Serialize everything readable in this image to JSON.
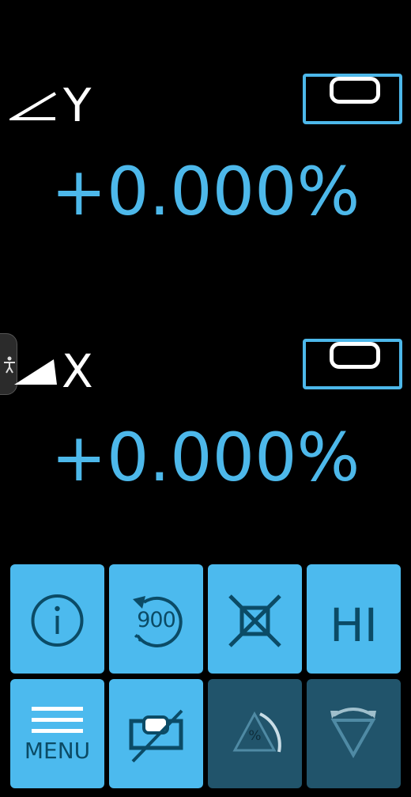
{
  "colors": {
    "accent": "#4db8ea",
    "button": "#4cbaee",
    "button_disabled": "#21546b",
    "button_ink": "#0b4b66",
    "disabled_ink": "#4f8aa4"
  },
  "y_axis": {
    "label": "Y",
    "icon": "angle-icon",
    "reading": "+0.000%",
    "level_icon": "bubble-level-icon"
  },
  "x_axis": {
    "label": "X",
    "icon": "slope-wedge-icon",
    "reading": "+0.000%",
    "level_icon": "bubble-level-icon"
  },
  "accessibility_tab": {
    "icon": "accessibility-person-icon"
  },
  "buttons": [
    {
      "name": "info",
      "icon": "info-icon",
      "enabled": true
    },
    {
      "name": "rotate",
      "icon": "rotate-counter-icon",
      "text": "900",
      "enabled": true
    },
    {
      "name": "calibrate-frame",
      "icon": "frame-crosshair-icon",
      "enabled": true
    },
    {
      "name": "hold",
      "text": "HI",
      "enabled": true
    },
    {
      "name": "menu",
      "icon": "menu-lines-icon",
      "text": "MENU",
      "enabled": true
    },
    {
      "name": "level-off",
      "icon": "level-slash-icon",
      "enabled": true
    },
    {
      "name": "slope-percent",
      "icon": "triangle-percent-icon",
      "text": "%",
      "enabled": false
    },
    {
      "name": "arc-mode",
      "icon": "triangle-arc-icon",
      "enabled": false
    }
  ]
}
